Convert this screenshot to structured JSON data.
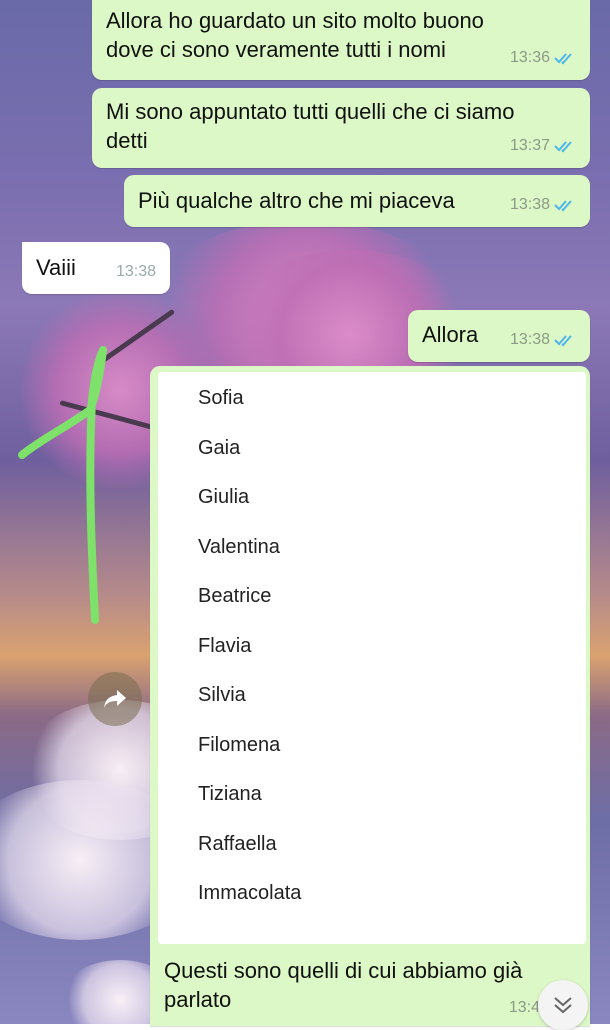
{
  "messages": [
    {
      "text": "Allora ho guardato un sito molto buono dove ci sono veramente tutti i nomi",
      "time": "13:36",
      "direction": "out"
    },
    {
      "text": "Mi sono appuntato tutti quelli che ci siamo detti",
      "time": "13:37",
      "direction": "out"
    },
    {
      "text": "Più qualche altro che mi piaceva",
      "time": "13:38",
      "direction": "out"
    },
    {
      "text": "Vaiii",
      "time": "13:38",
      "direction": "in"
    },
    {
      "text": "Allora",
      "time": "13:38",
      "direction": "out"
    }
  ],
  "names_list": [
    "Sofia",
    "Gaia",
    "Giulia",
    "Valentina",
    "Beatrice",
    "Flavia",
    "Silvia",
    "Filomena",
    "Tiziana",
    "Raffaella",
    "Immacolata"
  ],
  "caption": {
    "text": "Questi sono quelli di cui abbiamo già parlato",
    "time": "13:4"
  },
  "icons": {
    "forward": "share-forward-icon",
    "scroll": "double-chevron-down-icon",
    "read": "double-check-icon"
  },
  "colors": {
    "outgoing_bubble": "#dcf8c6",
    "incoming_bubble": "#ffffff",
    "read_ticks": "#4fb6ec",
    "annotation": "#7ee16a"
  }
}
